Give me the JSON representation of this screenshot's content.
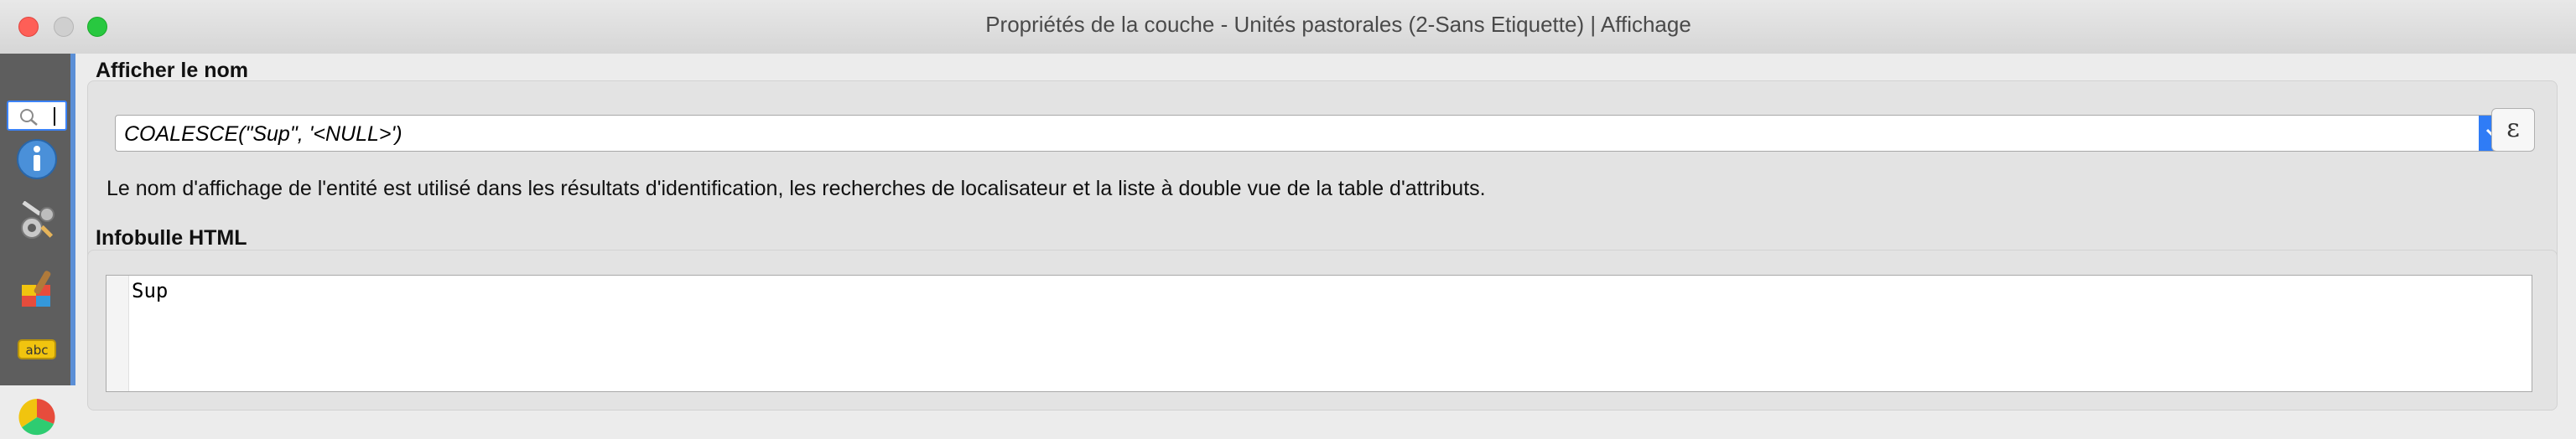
{
  "window": {
    "title": "Propriétés de la couche - Unités pastorales (2-Sans Etiquette) | Affichage"
  },
  "sidebar": {
    "search_placeholder": "",
    "items": [
      {
        "icon": "info-icon"
      },
      {
        "icon": "source-settings-icon"
      },
      {
        "icon": "symbology-brush-icon"
      },
      {
        "icon": "labels-abc-icon"
      },
      {
        "icon": "diagram-icon"
      }
    ]
  },
  "display_name": {
    "section_title": "Afficher le nom",
    "expression": "COALESCE(\"Sup\", '<NULL>')",
    "expression_button": "ε",
    "help_text": "Le nom d'affichage de l'entité est utilisé dans les résultats d'identification, les recherches de localisateur et la liste à double vue de la table d'attributs."
  },
  "html_tooltip": {
    "section_title": "Infobulle HTML",
    "content": "Sup"
  },
  "colors": {
    "accent": "#2f7cf6",
    "sidebar": "#5e5e5e"
  }
}
